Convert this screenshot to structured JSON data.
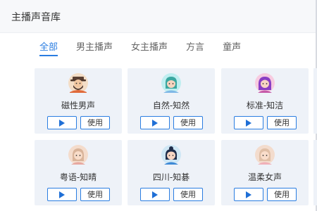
{
  "window": {
    "title": "主播声音库"
  },
  "tabs": [
    {
      "label": "全部",
      "active": true
    },
    {
      "label": "男主播声",
      "active": false
    },
    {
      "label": "女主播声",
      "active": false
    },
    {
      "label": "方言",
      "active": false
    },
    {
      "label": "童声",
      "active": false
    }
  ],
  "voices": [
    {
      "name": "磁性男声",
      "use_label": "使用",
      "avatar": "male-hat-avatar-icon"
    },
    {
      "name": "自然-知然",
      "use_label": "使用",
      "avatar": "female-teal-avatar-icon"
    },
    {
      "name": "标准-知洁",
      "use_label": "使用",
      "avatar": "female-purple-avatar-icon"
    },
    {
      "name": "粤语-知晴",
      "use_label": "使用",
      "avatar": "female-beige-avatar-icon"
    },
    {
      "name": "四川-知碁",
      "use_label": "使用",
      "avatar": "female-bun-avatar-icon"
    },
    {
      "name": "温柔女声",
      "use_label": "使用",
      "avatar": "female-soft-avatar-icon"
    }
  ],
  "colors": {
    "accent": "#2a7de1",
    "card_bg": "#eef2f8"
  }
}
